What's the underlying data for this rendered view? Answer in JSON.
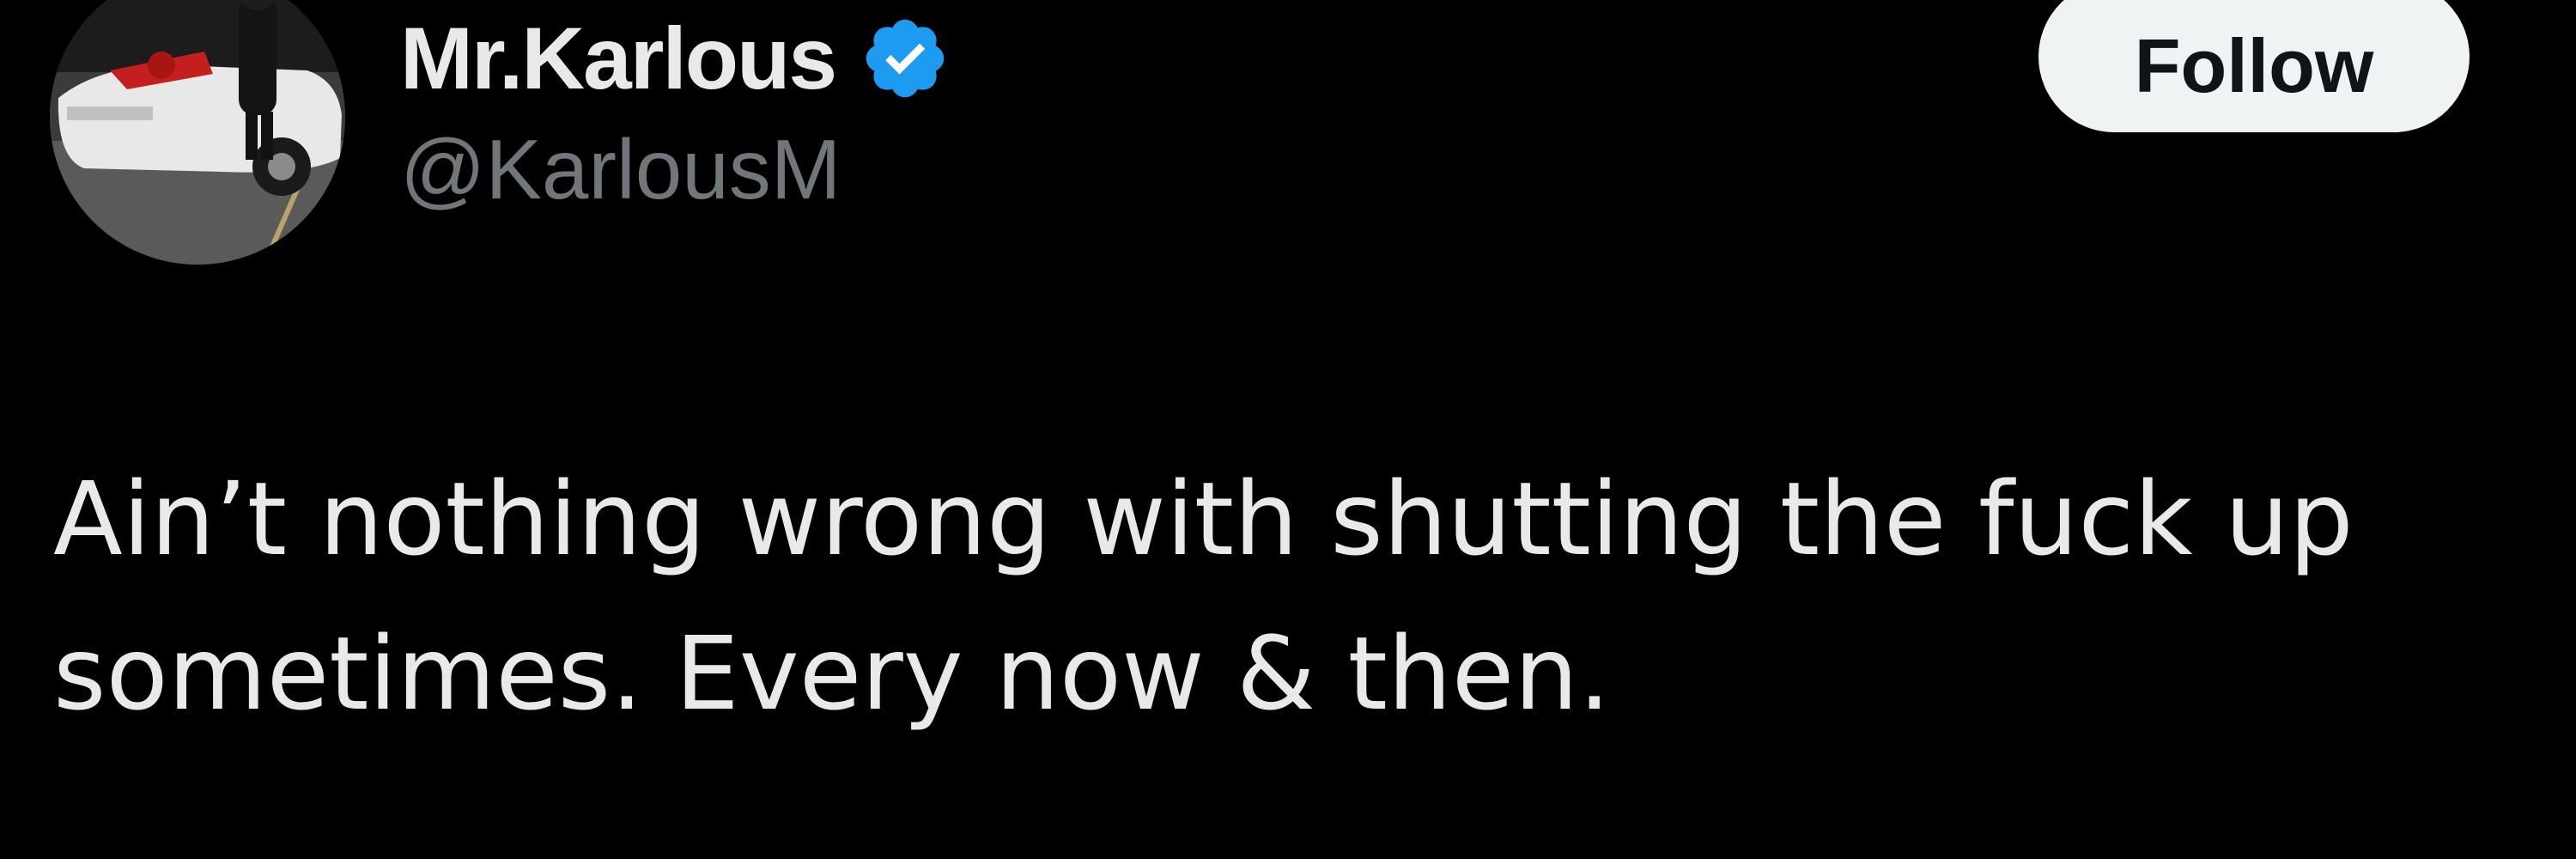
{
  "colors": {
    "background": "#000000",
    "primary_text": "#e7e9ea",
    "secondary_text": "#71767b",
    "verified_badge": "#1d9bf0",
    "follow_button_bg": "#eff3f4",
    "follow_button_text": "#0f1419"
  },
  "author": {
    "avatar_icon": "profile-photo",
    "display_name": "Mr.Karlous",
    "verified_icon": "verified-badge-icon",
    "handle": "@KarlousM"
  },
  "actions": {
    "follow_label": "Follow"
  },
  "tweet": {
    "text_line_1": "Ain’t nothing wrong with shutting the fuck up",
    "text_line_2": "sometimes. Every now & then."
  }
}
